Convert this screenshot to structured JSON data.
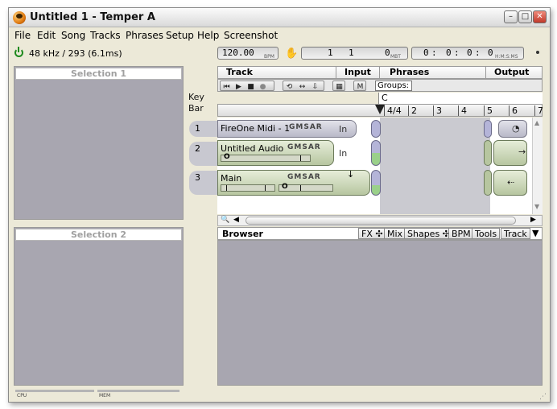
{
  "window": {
    "title": "Untitled 1 - Temper A",
    "buttons": {
      "minimize": "–",
      "maximize": "□",
      "close": "✕"
    }
  },
  "menu": [
    "File",
    "Edit",
    "Song",
    "Tracks",
    "Phrases",
    "Setup",
    "Help",
    "Screenshot"
  ],
  "status": {
    "sample_rate": "48 kHz / 293 (6.1ms)",
    "tempo": "120.00",
    "tempo_unit": "BPM",
    "position_bar": "1",
    "position_beat": "1",
    "position_tick": "0",
    "position_unit": "MBT",
    "time_h": "0",
    "time_m": "0",
    "time_s": "0",
    "time_f": "0",
    "time_unit": "H:M:S:MS"
  },
  "selection1": {
    "title": "Selection 1"
  },
  "selection2": {
    "title": "Selection 2"
  },
  "side_labels": {
    "key": "Key",
    "bar": "Bar"
  },
  "track_header": {
    "track": "Track",
    "input": "Input",
    "phrases": "Phrases",
    "output": "Output",
    "m_button": "M",
    "groups": "Groups:"
  },
  "ruler": {
    "key_label": "C",
    "time_sig": "4/4",
    "bars": [
      "2",
      "3",
      "4",
      "5",
      "6",
      "7"
    ]
  },
  "tracks": [
    {
      "number": "1",
      "name": "FireOne Midi - 1",
      "controls": "GMSAR",
      "input": "In",
      "type": "midi"
    },
    {
      "number": "2",
      "name": "Untitled Audio",
      "controls": "GMSAR",
      "input": "In",
      "meter_label": "O",
      "type": "audio"
    },
    {
      "number": "3",
      "name": "Main",
      "controls": "GMSAR",
      "meter_label": "O",
      "type": "master"
    }
  ],
  "browser": {
    "title": "Browser",
    "tabs": [
      "FX ✣",
      "Mix",
      "Shapes ✣",
      "BPM",
      "Tools",
      "Track"
    ],
    "menu_arrow": "▼"
  },
  "bottom_status": {
    "cpu": "CPU",
    "mem": "MEM"
  },
  "colors": {
    "panel_bg": "#a8a6b0",
    "track_green": "#b7c6a0",
    "track_midi": "#b9b9c8",
    "window_bg": "#ece9d8"
  }
}
